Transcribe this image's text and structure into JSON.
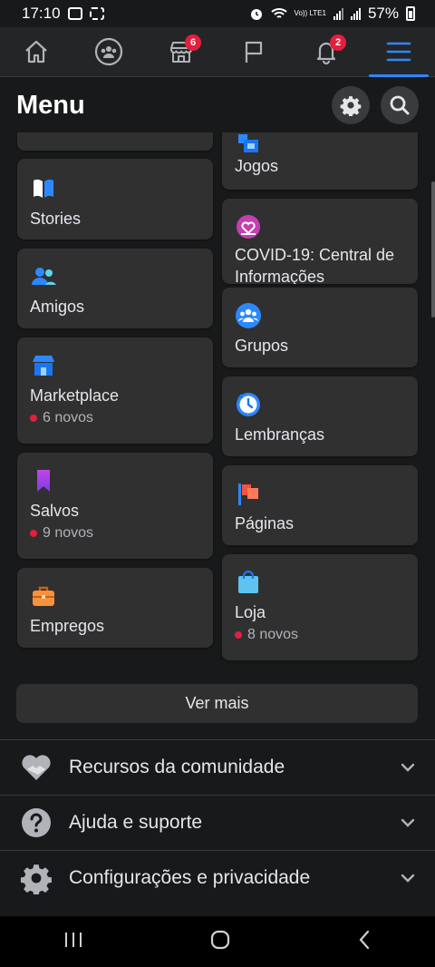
{
  "status_bar": {
    "time": "17:10",
    "volte": "Vo)) LTE1",
    "battery": "57%"
  },
  "top_nav": {
    "marketplace_badge": "6",
    "notifications_badge": "2"
  },
  "header": {
    "title": "Menu"
  },
  "left_tiles": [
    {
      "label": "Stories",
      "icon": "stories-book-icon"
    },
    {
      "label": "Amigos",
      "icon": "friends-icon"
    },
    {
      "label": "Marketplace",
      "icon": "marketplace-shop-icon",
      "sub": "6 novos"
    },
    {
      "label": "Salvos",
      "icon": "bookmark-icon",
      "sub": "9 novos"
    },
    {
      "label": "Empregos",
      "icon": "briefcase-icon"
    }
  ],
  "right_tiles": [
    {
      "label": "Jogos",
      "icon": "games-icon"
    },
    {
      "label": "COVID-19: Central de Informações",
      "icon": "covid-heart-icon"
    },
    {
      "label": "Grupos",
      "icon": "groups-icon"
    },
    {
      "label": "Lembranças",
      "icon": "memories-clock-icon"
    },
    {
      "label": "Páginas",
      "icon": "flag-icon"
    },
    {
      "label": "Loja",
      "icon": "shopping-bag-icon",
      "sub": "8 novos"
    }
  ],
  "see_more": "Ver mais",
  "sections": [
    {
      "label": "Recursos da comunidade",
      "icon": "handshake-heart-icon"
    },
    {
      "label": "Ajuda e suporte",
      "icon": "question-icon"
    },
    {
      "label": "Configurações e privacidade",
      "icon": "gear-icon"
    }
  ],
  "colors": {
    "accent": "#2d88ff",
    "badge": "#e41e3f",
    "tile_bg": "#303031",
    "page_bg": "#18191a"
  }
}
